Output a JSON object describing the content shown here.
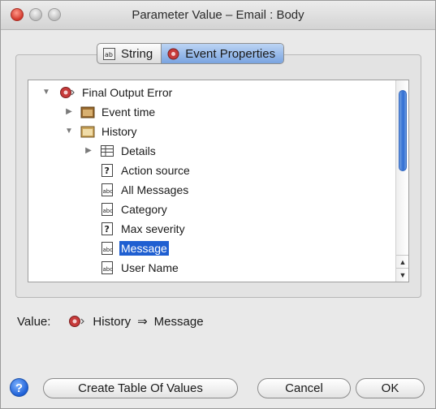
{
  "window": {
    "title": "Parameter Value – Email : Body"
  },
  "tabs": [
    {
      "label": "String",
      "icon": "string-icon",
      "active": false
    },
    {
      "label": "Event Properties",
      "icon": "event-properties-icon",
      "active": true
    }
  ],
  "tree": {
    "items": [
      {
        "label": "Final Output Error",
        "expand": "expanded",
        "icon": "event-icon"
      },
      {
        "label": "Event time",
        "expand": "collapsed",
        "icon": "folder-icon"
      },
      {
        "label": "History",
        "expand": "expanded",
        "icon": "folder-icon"
      },
      {
        "label": "Details",
        "expand": "collapsed",
        "icon": "table-icon"
      },
      {
        "label": "Action source",
        "expand": "none",
        "icon": "question-field-icon"
      },
      {
        "label": "All Messages",
        "expand": "none",
        "icon": "text-field-icon"
      },
      {
        "label": "Category",
        "expand": "none",
        "icon": "text-field-icon"
      },
      {
        "label": "Max severity",
        "expand": "none",
        "icon": "question-field-icon"
      },
      {
        "label": "Message",
        "expand": "none",
        "icon": "text-field-icon",
        "selected": true
      },
      {
        "label": "User Name",
        "expand": "none",
        "icon": "text-field-icon"
      }
    ]
  },
  "value": {
    "label": "Value:",
    "path": [
      "History",
      "Message"
    ],
    "separator": "⇒"
  },
  "buttons": {
    "help": "?",
    "create_table": "Create Table Of Values",
    "cancel": "Cancel",
    "ok": "OK"
  },
  "colors": {
    "selection": "#1f5fd1",
    "active_tab": "#7aa4e0",
    "close": "#d2372b"
  }
}
